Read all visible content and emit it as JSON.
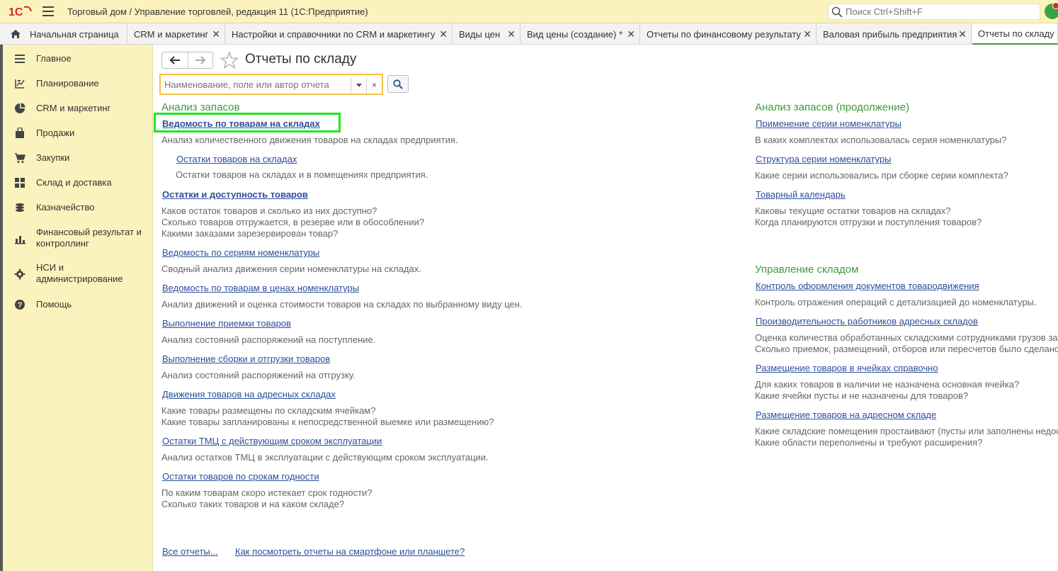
{
  "app": {
    "title": "Торговый дом / Управление торговлей, редакция 11  (1С:Предприятие)",
    "search_placeholder": "Поиск Ctrl+Shift+F"
  },
  "tabs": [
    {
      "label": "Начальная страница"
    },
    {
      "label": "CRM и маркетинг"
    },
    {
      "label": "Настройки и справочники по CRM и маркетингу"
    },
    {
      "label": "Виды цен"
    },
    {
      "label": "Вид цены (создание) *"
    },
    {
      "label": "Отчеты по финансовому результату"
    },
    {
      "label": "Валовая прибыль предприятия"
    },
    {
      "label": "Отчеты по складу"
    }
  ],
  "sidebar": {
    "items": [
      {
        "label": "Главное",
        "icon": "menu-icon"
      },
      {
        "label": "Планирование",
        "icon": "planning-icon"
      },
      {
        "label": "CRM и маркетинг",
        "icon": "pie-chart-icon"
      },
      {
        "label": "Продажи",
        "icon": "shopping-bag-icon"
      },
      {
        "label": "Закупки",
        "icon": "cart-icon"
      },
      {
        "label": "Склад и доставка",
        "icon": "warehouse-icon"
      },
      {
        "label": "Казначейство",
        "icon": "coins-icon"
      },
      {
        "label": "Финансовый результат и контроллинг",
        "icon": "bar-chart-icon"
      },
      {
        "label": "НСИ и администрирование",
        "icon": "gear-icon"
      },
      {
        "label": "Помощь",
        "icon": "help-icon"
      }
    ]
  },
  "page": {
    "title": "Отчеты по складу",
    "report_search_placeholder": "Наименование, поле или автор отчета",
    "clear_symbol": "×"
  },
  "left_column": {
    "section_title": "Анализ запасов",
    "reports": [
      {
        "title": "Ведомость по товарам на складах",
        "desc": "Анализ количественного движения товаров на складах предприятия."
      },
      {
        "title": "Остатки товаров на складах",
        "desc": "Остатки товаров на складах и в помещениях предприятия."
      },
      {
        "title": "Остатки и доступность товаров",
        "desc1": "Каков остаток товаров и сколько из них доступно?",
        "desc2": "Сколько товаров отгружается, в резерве или в обособлении?",
        "desc3": "Какими заказами зарезервирован товар?"
      },
      {
        "title": "Ведомость по сериям номенклатуры",
        "desc": "Сводный анализ движения серии номенклатуры на складах."
      },
      {
        "title": "Ведомость по товарам в ценах номенклатуры",
        "desc": "Анализ движений и оценка стоимости товаров на складах по выбранному виду цен."
      },
      {
        "title": "Выполнение приемки товаров",
        "desc": "Анализ состояний распоряжений на поступление."
      },
      {
        "title": "Выполнение сборки и отгрузки товаров",
        "desc": "Анализ состояний распоряжений на отгрузку."
      },
      {
        "title": "Движения товаров на адресных складах",
        "desc1": "Какие товары размещены по складским ячейкам?",
        "desc2": "Какие товары запланированы к непосредственной выемке или размещению?"
      },
      {
        "title": "Остатки ТМЦ с действующим сроком эксплуатации",
        "desc": "Анализ остатков ТМЦ в эксплуатации с действующим сроком эксплуатации."
      },
      {
        "title": "Остатки товаров по срокам годности",
        "desc1": "По каким товарам скоро истекает срок годности?",
        "desc2": "Сколько таких товаров и на каком складе?"
      }
    ]
  },
  "right_column": {
    "section1_title": "Анализ запасов (продолжение)",
    "section1": [
      {
        "title": "Применение серии номенклатуры",
        "desc": "В каких комплектах использовалась серия номенклатуры?"
      },
      {
        "title": "Структура серии номенклатуры",
        "desc": "Какие серии использовались при сборке серии комплекта?"
      },
      {
        "title": "Товарный календарь",
        "desc1": "Каковы текущие остатки товаров на складах?",
        "desc2": "Когда планируются отгрузки и поступления товаров?"
      }
    ],
    "section2_title": "Управление складом",
    "section2": [
      {
        "title": "Контроль оформления документов товародвижения",
        "desc": "Контроль отражения операций с детализацией до номенклатуры."
      },
      {
        "title": "Производительность работников адресных складов",
        "desc1": "Оценка количества обработанных складскими сотрудниками грузов за",
        "desc2": "Сколько приемок, размещений, отборов или пересчетов было сделано"
      },
      {
        "title": "Размещение товаров в ячейках справочно",
        "desc1": "Для каких товаров в наличии не назначена основная ячейка?",
        "desc2": "Какие ячейки пусты и не назначены для товаров?"
      },
      {
        "title": "Размещение товаров на адресном складе",
        "desc1": "Какие складские помещения простаивают (пусты или заполнены недос",
        "desc2": "Какие области переполнены и требуют расширения?"
      }
    ]
  },
  "footer": {
    "all_reports": "Все отчеты...",
    "mobile_link": "Как посмотреть отчеты на смартфоне или планшете?"
  },
  "colors": {
    "accent_green": "#3c9c3c",
    "link_blue": "#2c4f9a",
    "panel_yellow": "#fbf3bd",
    "highlight": "#1fe81f"
  }
}
